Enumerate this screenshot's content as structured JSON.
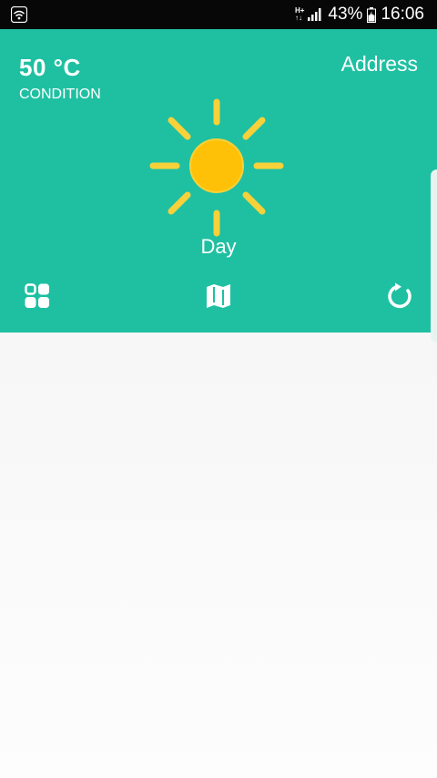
{
  "status_bar": {
    "network_type_top": "H+",
    "network_type_bottom": "↑↓",
    "battery": "43%",
    "time": "16:06",
    "icons": [
      "wifi-icon",
      "signal-icon",
      "battery-icon"
    ]
  },
  "weather": {
    "temperature": "50 °C",
    "condition": "CONDITION",
    "address": "Address",
    "period": "Day",
    "icon": "sun-icon"
  },
  "toolbar": {
    "icons": [
      "grid-icon",
      "map-icon",
      "refresh-icon"
    ]
  },
  "colors": {
    "header": "#1fc0a2",
    "sun": "#ffc107",
    "rays": "#f7d13a",
    "status_bar": "#070707"
  }
}
